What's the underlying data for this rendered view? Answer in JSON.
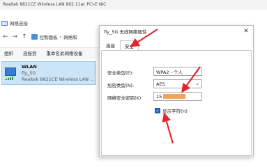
{
  "background_window": {
    "title": "Realtek 8821CE Wireless LAN 802.11ac PCI-E NIC",
    "caption": "网络连接",
    "breadcrumb": [
      "控制面板",
      "网络和"
    ],
    "toolbar": [
      "组织",
      "连接到",
      "重命名此网络设备"
    ],
    "adapter": {
      "name": "WLAN",
      "network": "fly_5G",
      "device": "Realtek 8821CE Wireless LAN ..."
    }
  },
  "dialog": {
    "title": "fly_5G 无线网络属性",
    "close_glyph": "✕",
    "tabs": [
      {
        "label": "连接",
        "active": false
      },
      {
        "label": "安全",
        "active": true
      }
    ],
    "security_type_label": "安全类型(E):",
    "security_type_value": "WPA2 - 个人",
    "encryption_type_label": "加密类型(N):",
    "encryption_type_value": "AES",
    "key_label": "网络安全密钥(K)",
    "key_value_visible": "15",
    "show_chars_label": "显示字符(H)",
    "show_chars_checked": true
  },
  "annotation_color": "#e0262c",
  "redaction_color": "#f4a45a",
  "icons": {
    "back": "←",
    "forward": "→",
    "up": "↑",
    "chevron": "⌄",
    "check": "✓"
  }
}
